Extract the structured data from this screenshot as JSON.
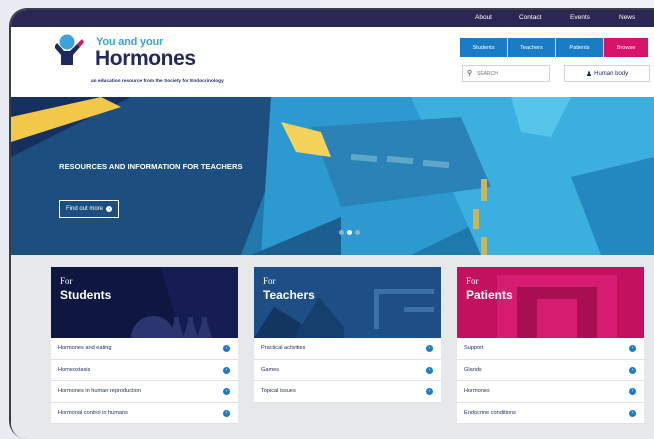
{
  "topnav": [
    "About",
    "Contact",
    "Events",
    "News"
  ],
  "logo": {
    "sub": "You and your",
    "main": "Hormones",
    "tagline": "an education resource from the Society for Endocrinology"
  },
  "navbuttons": [
    "Students",
    "Teachers",
    "Patients",
    "Browse"
  ],
  "search": {
    "placeholder": "SEARCH",
    "icon": "search-icon"
  },
  "human_body": "Human body",
  "hero": {
    "title": "RESOURCES AND INFORMATION FOR TEACHERS",
    "button": "Find out more"
  },
  "colors": {
    "dark_navy": "#2b2754",
    "blue": "#1a7cc4",
    "pink": "#d8136a",
    "logo_blue": "#3aa2dd"
  },
  "cards": [
    {
      "for": "For",
      "title": "Students",
      "items": [
        "Hormones and eating",
        "Homeostasis",
        "Hormones in human reproduction",
        "Hormonal control in humans"
      ]
    },
    {
      "for": "For",
      "title": "Teachers",
      "items": [
        "Practical activities",
        "Games",
        "Topical issues"
      ]
    },
    {
      "for": "For",
      "title": "Patients",
      "items": [
        "Support",
        "Glands",
        "Hormones",
        "Endocrine conditions"
      ]
    }
  ]
}
